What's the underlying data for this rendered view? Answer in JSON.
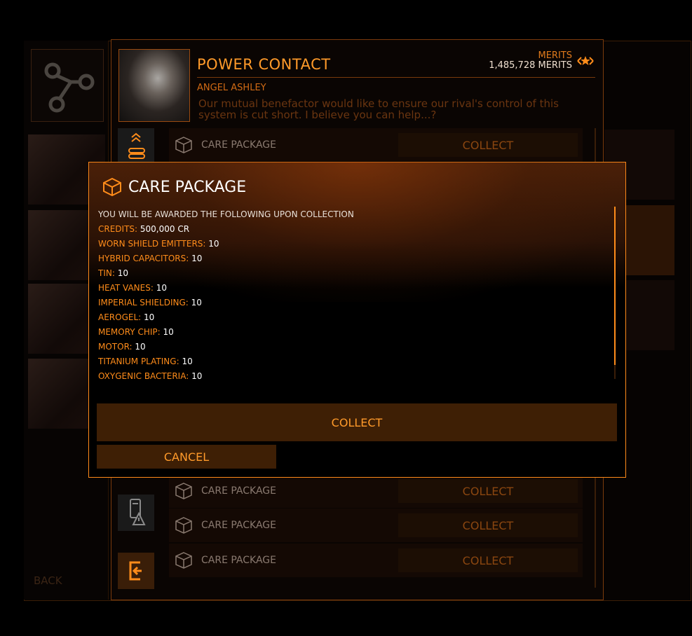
{
  "background": {
    "back_label": "BACK"
  },
  "contact": {
    "title": "POWER CONTACT",
    "name": "ANGEL ASHLEY",
    "message": "Our mutual benefactor would like to ensure our rival's control of this system is cut short. I believe you can help...?",
    "merits_label": "MERITS",
    "merits_value": "1,485,728 MERITS"
  },
  "rows": [
    {
      "label": "CARE PACKAGE",
      "button": "COLLECT"
    },
    {
      "label": "CARE PACKAGE",
      "button": "COLLECT"
    },
    {
      "label": "CARE PACKAGE",
      "button": "COLLECT"
    },
    {
      "label": "CARE PACKAGE",
      "button": "COLLECT"
    }
  ],
  "dialog": {
    "title": "CARE PACKAGE",
    "intro": "YOU WILL BE AWARDED THE FOLLOWING UPON COLLECTION",
    "items": [
      {
        "key": "CREDITS:",
        "value": "500,000 CR"
      },
      {
        "key": "WORN SHIELD EMITTERS:",
        "value": "10"
      },
      {
        "key": "HYBRID CAPACITORS:",
        "value": "10"
      },
      {
        "key": "TIN:",
        "value": "10"
      },
      {
        "key": "HEAT VANES:",
        "value": "10"
      },
      {
        "key": "IMPERIAL SHIELDING:",
        "value": "10"
      },
      {
        "key": "AEROGEL:",
        "value": "10"
      },
      {
        "key": "MEMORY CHIP:",
        "value": "10"
      },
      {
        "key": "MOTOR:",
        "value": "10"
      },
      {
        "key": "TITANIUM PLATING:",
        "value": "10"
      },
      {
        "key": "OXYGENIC BACTERIA:",
        "value": "10"
      }
    ],
    "collect_label": "COLLECT",
    "cancel_label": "CANCEL"
  },
  "colors": {
    "accent": "#ff8c1a",
    "button_bg": "#3e1f05",
    "panel_bg": "#0a0503"
  }
}
